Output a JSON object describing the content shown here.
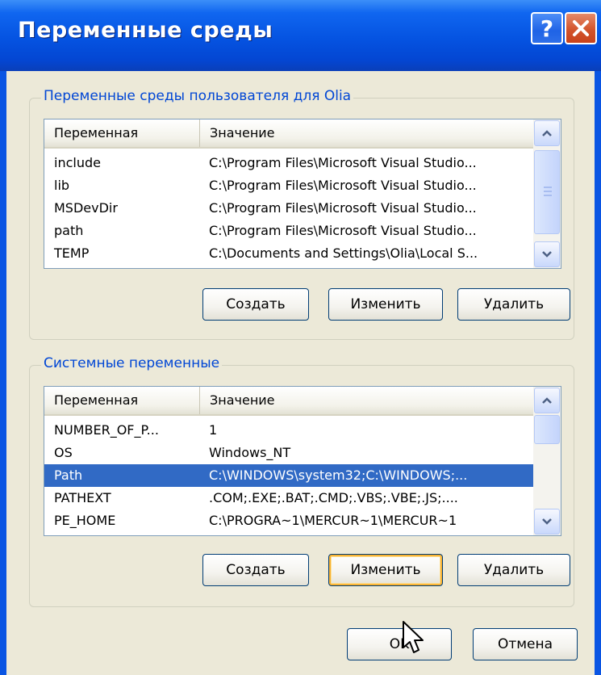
{
  "window": {
    "title": "Переменные среды",
    "help_symbol": "?"
  },
  "user_vars": {
    "group_label": "Переменные среды пользователя для Olia",
    "columns": [
      "Переменная",
      "Значение"
    ],
    "rows": [
      {
        "name": "include",
        "value": "C:\\Program Files\\Microsoft Visual Studio..."
      },
      {
        "name": "lib",
        "value": "C:\\Program Files\\Microsoft Visual Studio..."
      },
      {
        "name": "MSDevDir",
        "value": "C:\\Program Files\\Microsoft Visual Studio..."
      },
      {
        "name": "path",
        "value": "C:\\Program Files\\Microsoft Visual Studio..."
      },
      {
        "name": "TEMP",
        "value": "C:\\Documents and Settings\\Olia\\Local S..."
      }
    ],
    "buttons": {
      "create": "Создать",
      "edit": "Изменить",
      "delete": "Удалить"
    }
  },
  "system_vars": {
    "group_label": "Системные переменные",
    "columns": [
      "Переменная",
      "Значение"
    ],
    "rows": [
      {
        "name": "NUMBER_OF_P...",
        "value": "1"
      },
      {
        "name": "OS",
        "value": "Windows_NT"
      },
      {
        "name": "Path",
        "value": "C:\\WINDOWS\\system32;C:\\WINDOWS;..."
      },
      {
        "name": "PATHEXT",
        "value": ".COM;.EXE;.BAT;.CMD;.VBS;.VBE;.JS;...."
      },
      {
        "name": "PE_HOME",
        "value": "C:\\PROGRA~1\\MERCUR~1\\MERCUR~1"
      }
    ],
    "selected_row": "Path",
    "buttons": {
      "create": "Создать",
      "edit": "Изменить",
      "delete": "Удалить"
    }
  },
  "dialog_buttons": {
    "ok": "OK",
    "cancel": "Отмена"
  },
  "icons": {
    "help": "help-icon",
    "close": "close-icon",
    "scroll_up": "chevron-up-icon",
    "scroll_down": "chevron-down-icon",
    "cursor": "mouse-pointer-icon"
  },
  "colors": {
    "titlebar": "#0553e1",
    "group_label": "#0046d5",
    "selection": "#316ac5",
    "dialog_bg": "#ece9d8",
    "focus_ring": "#f8b335"
  }
}
